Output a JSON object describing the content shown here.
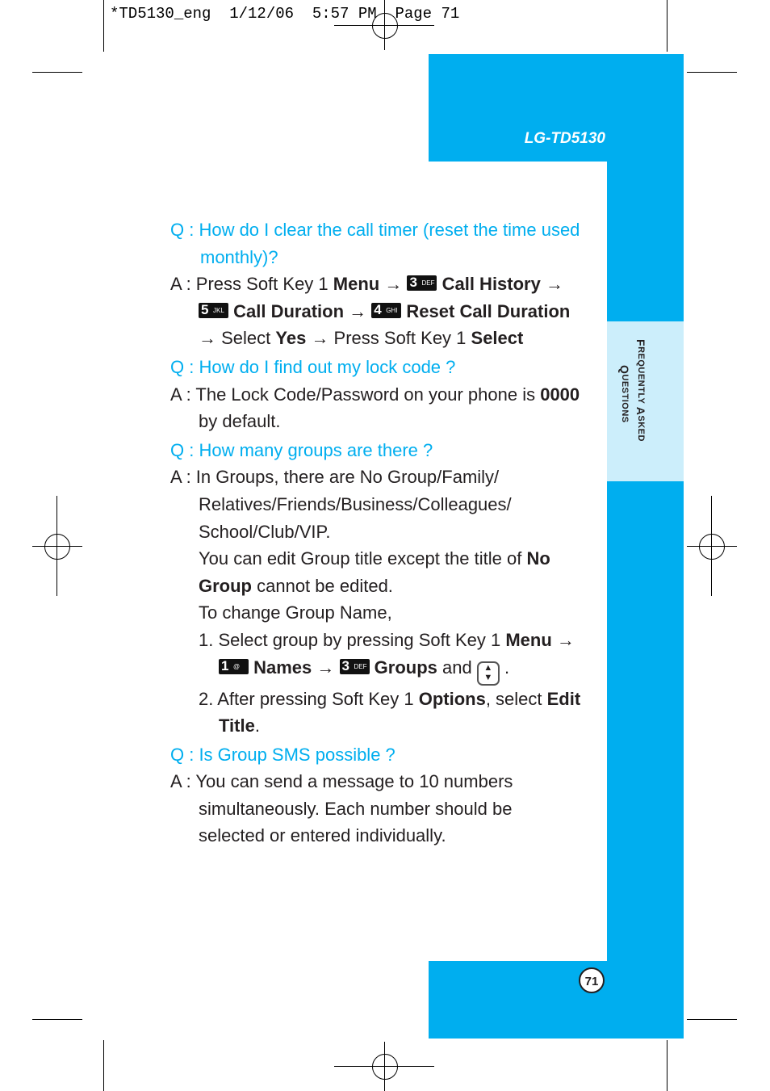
{
  "slug": "*TD5130_eng  1/12/06  5:57 PM  Page 71",
  "model": "LG-TD5130",
  "section_tab": {
    "first_cap": "F",
    "first_rest": "REQUENTLY ",
    "second_cap": "A",
    "second_rest": "SKED",
    "third_cap": "Q",
    "third_rest": "UESTIONS"
  },
  "page_number": "71",
  "keys": {
    "k3": {
      "num": "3",
      "letters": "DEF"
    },
    "k5": {
      "num": "5",
      "letters": "JKL"
    },
    "k4": {
      "num": "4",
      "letters": "GHI"
    },
    "k1": {
      "num": "1",
      "letters": "@"
    }
  },
  "arrow": "→",
  "faq": {
    "q1": "Q : How do I clear the call timer (reset the time used monthly)?",
    "a1": {
      "prefix": "A : Press Soft Key 1 ",
      "menu": "Menu",
      "call_history": "Call History",
      "call_duration": "Call Duration",
      "reset_call_duration": "Reset Call Duration",
      "select_txt": " Select ",
      "yes": "Yes",
      "press_txt": " Press Soft Key 1 ",
      "select": "Select"
    },
    "q2": "Q : How do I find out my lock code ?",
    "a2": {
      "prefix": "A : The Lock Code/Password on your phone is ",
      "code": "0000",
      "suffix": " by default."
    },
    "q3": "Q : How many groups are there ?",
    "a3": {
      "line1": "A : In Groups, there are No Group/Family/ Relatives/Friends/Business/Colleagues/ School/Club/VIP.",
      "edit_prefix": "You can edit Group title except the title of ",
      "no_group": "No Group",
      "edit_suffix": " cannot be edited.",
      "change": "To change Group Name,",
      "step1_prefix": "1. Select group by pressing Soft Key 1 ",
      "menu": "Menu",
      "names": "Names",
      "groups": "Groups",
      "and": " and ",
      "period": " .",
      "step2_prefix": "2. After pressing Soft Key 1 ",
      "options": "Options",
      "step2_mid": ", select ",
      "edit_title": "Edit Title",
      "step2_end": "."
    },
    "q4": "Q : Is Group SMS possible ?",
    "a4": "A : You can send a message to 10 numbers simultaneously. Each number should be selected or entered individually."
  }
}
